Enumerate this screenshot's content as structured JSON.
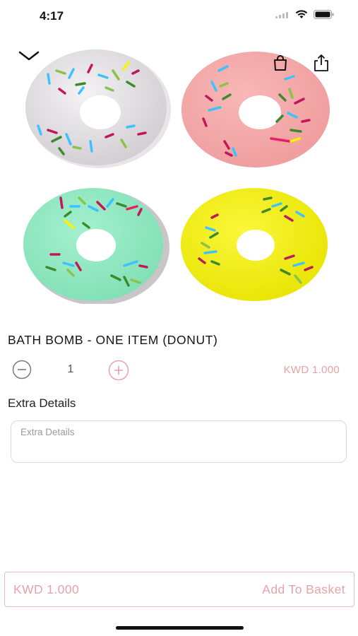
{
  "status_bar": {
    "time": "4:17",
    "icons": [
      "signal-icon",
      "wifi-icon",
      "battery-icon"
    ]
  },
  "nav": {
    "back_icon": "chevron-down-icon",
    "bag_icon": "shopping-bag-icon",
    "share_icon": "share-icon"
  },
  "product": {
    "title": "BATH BOMB - ONE ITEM (DONUT)",
    "quantity": "1",
    "price": "KWD 1.000",
    "image": {
      "description_icon": "donut-image",
      "donut_colors": [
        "#dcd8dc",
        "#f2a3a4",
        "#8fe8bf",
        "#f4f000"
      ]
    }
  },
  "extra_details": {
    "label": "Extra Details",
    "placeholder": "Extra Details",
    "value": ""
  },
  "basket": {
    "price": "KWD 1.000",
    "button_label": "Add To Basket"
  },
  "colors": {
    "accent": "#e8a2a9",
    "border": "#efb9be"
  }
}
